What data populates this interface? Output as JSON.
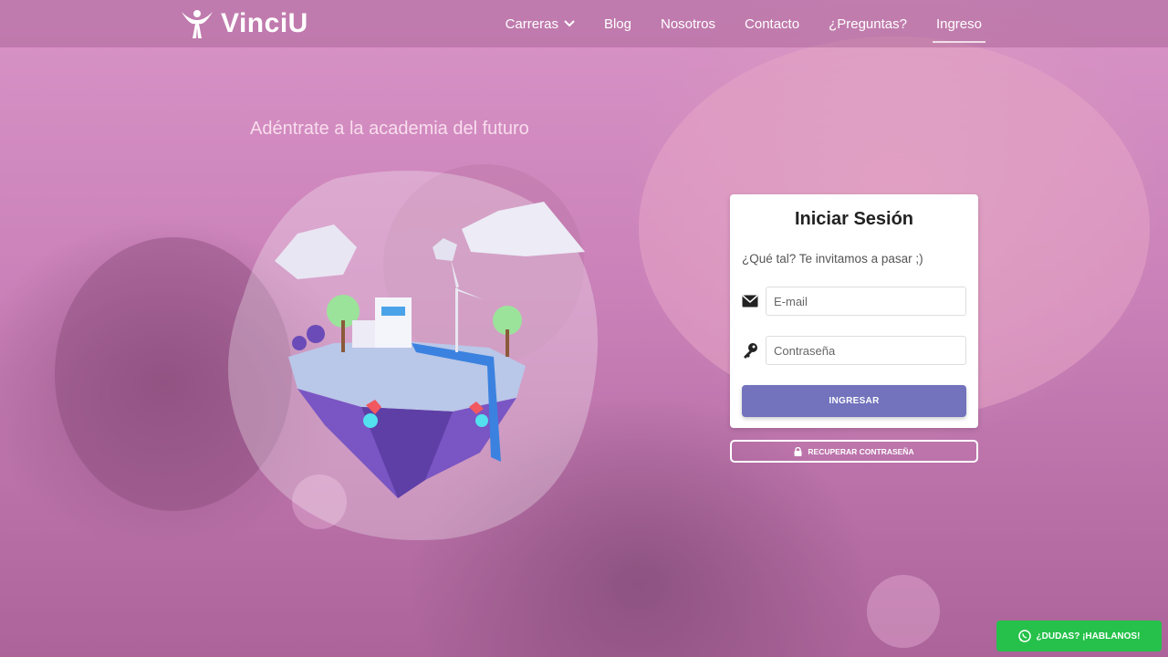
{
  "brand": {
    "name": "VinciU"
  },
  "nav": {
    "items": [
      {
        "label": "Carreras"
      },
      {
        "label": "Blog"
      },
      {
        "label": "Nosotros"
      },
      {
        "label": "Contacto"
      },
      {
        "label": "¿Preguntas?"
      },
      {
        "label": "Ingreso"
      }
    ],
    "active": "Ingreso"
  },
  "hero": {
    "tagline": "Adéntrate a la academia del futuro"
  },
  "login": {
    "title": "Iniciar Sesión",
    "subtitle": "¿Qué tal? Te invitamos a pasar ;)",
    "email_placeholder": "E-mail",
    "password_placeholder": "Contraseña",
    "submit_label": "INGRESAR",
    "recover_label": "RECUPERAR CONTRASEÑA"
  },
  "chat": {
    "label": "¿DUDAS? ¡HABLANOS!"
  },
  "colors": {
    "accent": "#7272bd",
    "whatsapp": "#25c14a",
    "overlay": "#d678be"
  },
  "icons": {
    "logo": "person-arms-up-icon",
    "email": "envelope-icon",
    "password": "key-icon",
    "recover": "lock-icon",
    "chat": "whatsapp-icon",
    "dropdown": "chevron-down-icon"
  }
}
